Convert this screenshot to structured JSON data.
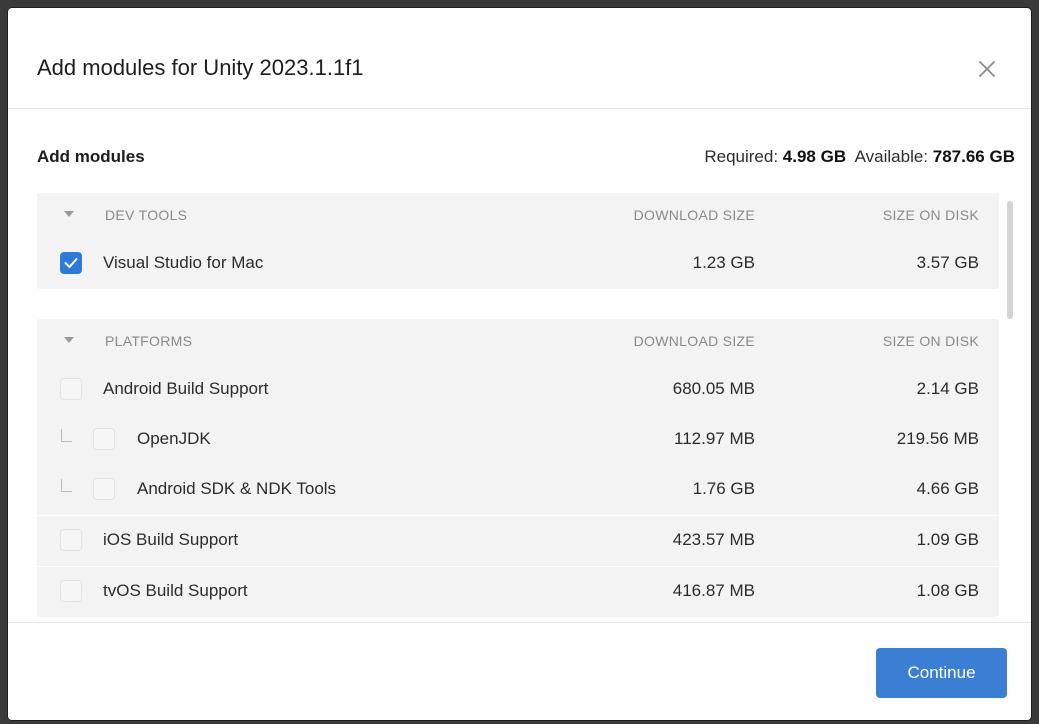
{
  "dialog": {
    "title": "Add modules for Unity 2023.1.1f1",
    "close_icon": "close-icon"
  },
  "summary": {
    "heading": "Add modules",
    "required_label": "Required:",
    "required_value": "4.98 GB",
    "available_label": "Available:",
    "available_value": "787.66 GB"
  },
  "groups": [
    {
      "name": "DEV TOOLS",
      "download_header": "DOWNLOAD SIZE",
      "disk_header": "SIZE ON DISK",
      "expanded": true,
      "modules": [
        {
          "name": "Visual Studio for Mac",
          "download": "1.23 GB",
          "disk": "3.57 GB",
          "checked": true,
          "child": false
        }
      ]
    },
    {
      "name": "PLATFORMS",
      "download_header": "DOWNLOAD SIZE",
      "disk_header": "SIZE ON DISK",
      "expanded": true,
      "modules": [
        {
          "name": "Android Build Support",
          "download": "680.05 MB",
          "disk": "2.14 GB",
          "checked": false,
          "child": false
        },
        {
          "name": "OpenJDK",
          "download": "112.97 MB",
          "disk": "219.56 MB",
          "checked": false,
          "child": true
        },
        {
          "name": "Android SDK & NDK Tools",
          "download": "1.76 GB",
          "disk": "4.66 GB",
          "checked": false,
          "child": true
        },
        {
          "name": "iOS Build Support",
          "download": "423.57 MB",
          "disk": "1.09 GB",
          "checked": false,
          "child": false
        },
        {
          "name": "tvOS Build Support",
          "download": "416.87 MB",
          "disk": "1.08 GB",
          "checked": false,
          "child": false
        }
      ]
    }
  ],
  "footer": {
    "continue_label": "Continue"
  },
  "colors": {
    "accent": "#3a7fd3",
    "checkbox_checked": "#2f7ad8",
    "group_background": "#f3f3f3"
  }
}
